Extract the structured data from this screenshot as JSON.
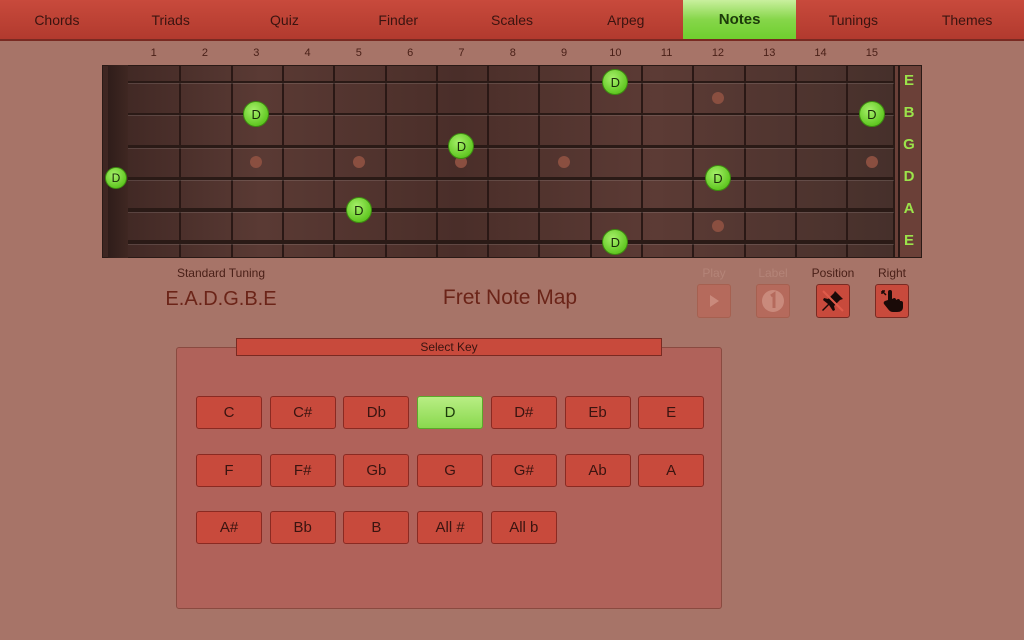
{
  "nav": {
    "tabs": [
      "Chords",
      "Triads",
      "Quiz",
      "Finder",
      "Scales",
      "Arpeg",
      "Notes",
      "Tunings",
      "Themes"
    ],
    "active_index": 6
  },
  "fretboard": {
    "fret_numbers": [
      "1",
      "2",
      "3",
      "4",
      "5",
      "6",
      "7",
      "8",
      "9",
      "10",
      "11",
      "12",
      "13",
      "14",
      "15"
    ],
    "string_labels": [
      "E",
      "B",
      "G",
      "D",
      "A",
      "E"
    ],
    "notes": [
      {
        "label": "D",
        "string": 1,
        "fret": 10
      },
      {
        "label": "D",
        "string": 2,
        "fret": 3
      },
      {
        "label": "D",
        "string": 2,
        "fret": 15
      },
      {
        "label": "D",
        "string": 3,
        "fret": 7
      },
      {
        "label": "D",
        "string": 4,
        "fret": 0
      },
      {
        "label": "D",
        "string": 4,
        "fret": 12
      },
      {
        "label": "D",
        "string": 5,
        "fret": 5
      },
      {
        "label": "D",
        "string": 6,
        "fret": 10
      }
    ]
  },
  "info": {
    "tuning_caption": "Standard Tuning",
    "tuning_value": "E.A.D.G.B.E",
    "title": "Fret Note Map"
  },
  "tools": {
    "play": "Play",
    "label": "Label",
    "position": "Position",
    "right": "Right"
  },
  "key_panel": {
    "header": "Select Key",
    "rows": [
      [
        "C",
        "C#",
        "Db",
        "D",
        "D#",
        "Eb",
        "E"
      ],
      [
        "F",
        "F#",
        "Gb",
        "G",
        "G#",
        "Ab",
        "A"
      ],
      [
        "A#",
        "Bb",
        "B",
        "All #",
        "All b"
      ]
    ],
    "selected": "D"
  },
  "colors": {
    "background": "#a77468",
    "accent_red": "#c84a3c",
    "active_green": "#86d64a",
    "string_label_green": "#9be34a"
  }
}
